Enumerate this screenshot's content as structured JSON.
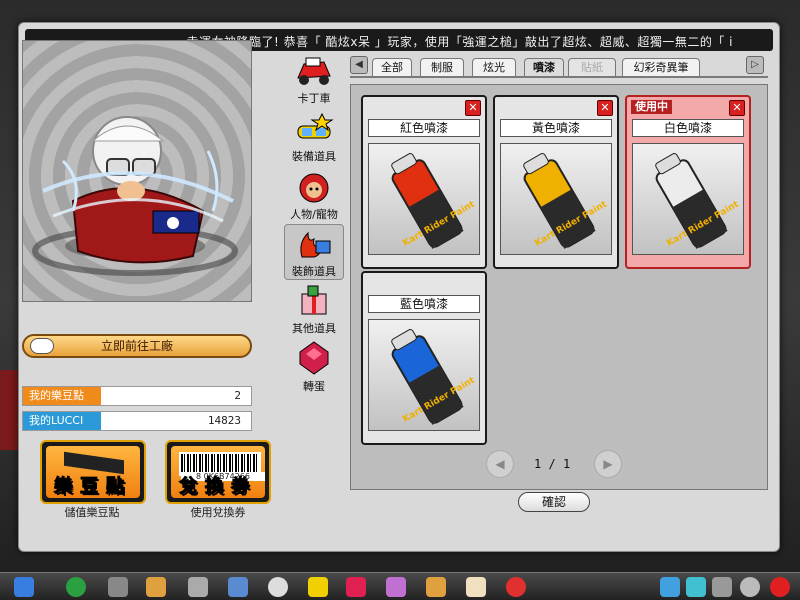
{
  "marquee": "幸運女神降臨了! 恭喜「 酷炫x呆 」玩家，使用「強運之槌」敲出了超炫、超威、超獨一無二的「 i",
  "factory_button": "立即前往工廠",
  "points": [
    {
      "label": "我的樂豆點",
      "value": "2",
      "color": "#f08a1a"
    },
    {
      "label": "我的LUCCI",
      "value": "14823",
      "color": "#2a9ad8"
    }
  ],
  "buttons": {
    "store_big": "樂豆點",
    "store_caption": "儲值樂豆點",
    "coupon_big": "兌換券",
    "coupon_caption": "使用兌換券",
    "barcode_number": "8  0K6B74266"
  },
  "categories": [
    {
      "label": "卡丁車",
      "icon": "kart-icon"
    },
    {
      "label": "裝備道具",
      "icon": "goggles-icon"
    },
    {
      "label": "人物/寵物",
      "icon": "character-icon"
    },
    {
      "label": "裝飾道具",
      "icon": "decoration-icon",
      "active": true
    },
    {
      "label": "其他道具",
      "icon": "giftbox-icon"
    },
    {
      "label": "轉蛋",
      "icon": "gem-icon"
    }
  ],
  "tabs": [
    {
      "label": "全部"
    },
    {
      "label": "制服"
    },
    {
      "label": "炫光"
    },
    {
      "label": "噴漆",
      "active": true
    },
    {
      "label": "貼紙",
      "disabled": true
    },
    {
      "label": "幻彩奇異筆"
    }
  ],
  "items": [
    {
      "name": "紅色噴漆",
      "color": "#e03010",
      "in_use": false
    },
    {
      "name": "黃色噴漆",
      "color": "#f0b000",
      "in_use": false
    },
    {
      "name": "白色噴漆",
      "color": "#e8e8e8",
      "in_use": true,
      "badge": "使用中"
    },
    {
      "name": "藍色噴漆",
      "color": "#1a66d8",
      "in_use": false
    }
  ],
  "can_label": "Kart Rider Paint",
  "close_symbol": "✕",
  "pagination": {
    "current": "1",
    "separator": "/",
    "total": "1"
  },
  "confirm": "確認"
}
